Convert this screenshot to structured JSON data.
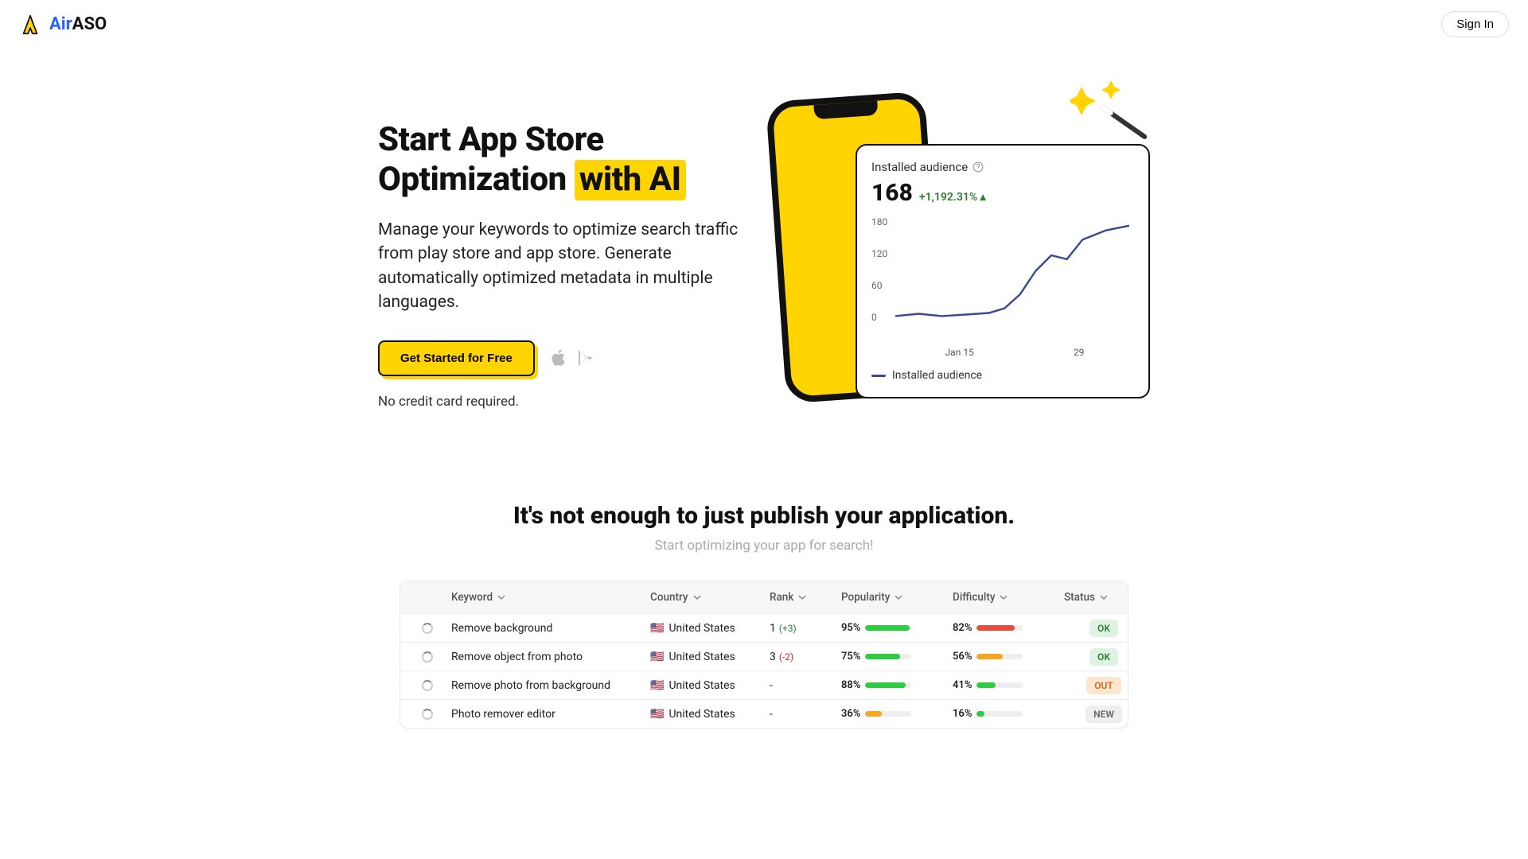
{
  "header": {
    "brand_prefix": "Air",
    "brand_suffix": "ASO",
    "signin": "Sign In"
  },
  "hero": {
    "title_line1": "Start App Store",
    "title_line2_a": "Optimization",
    "title_line2_b": "with AI",
    "subtitle": "Manage your keywords to optimize search traffic from play store and app store. Generate automatically optimized metadata in multiple languages.",
    "cta": "Get Started for Free",
    "nocard": "No credit card required."
  },
  "analytics": {
    "title": "Installed audience",
    "big": "168",
    "growth": "+1,192.31%",
    "ylabels": [
      "180",
      "120",
      "60",
      "0"
    ],
    "xlabels": [
      "Jan 15",
      "29"
    ],
    "legend": "Installed audience"
  },
  "section2": {
    "title": "It's not enough to just publish your application.",
    "sub": "Start optimizing your app for search!"
  },
  "table": {
    "headers": {
      "keyword": "Keyword",
      "country": "Country",
      "rank": "Rank",
      "popularity": "Popularity",
      "difficulty": "Difficulty",
      "status": "Status"
    },
    "rows": [
      {
        "keyword": "Remove background",
        "country": "United States",
        "rank": "1",
        "rank_delta": "(+3)",
        "delta_class": "delta-up",
        "pop": "95%",
        "pop_pct": 95,
        "pop_color": "#2ecc40",
        "diff": "82%",
        "diff_pct": 82,
        "diff_color": "#e74c3c",
        "status": "OK",
        "status_class": "badge-ok"
      },
      {
        "keyword": "Remove object from photo",
        "country": "United States",
        "rank": "3",
        "rank_delta": "(-2)",
        "delta_class": "delta-down",
        "pop": "75%",
        "pop_pct": 75,
        "pop_color": "#2ecc40",
        "diff": "56%",
        "diff_pct": 56,
        "diff_color": "#f5a623",
        "status": "OK",
        "status_class": "badge-ok"
      },
      {
        "keyword": "Remove photo from background",
        "country": "United States",
        "rank": "-",
        "rank_delta": "",
        "delta_class": "",
        "pop": "88%",
        "pop_pct": 88,
        "pop_color": "#2ecc40",
        "diff": "41%",
        "diff_pct": 41,
        "diff_color": "#2ecc40",
        "status": "OUT",
        "status_class": "badge-out"
      },
      {
        "keyword": "Photo remover editor",
        "country": "United States",
        "rank": "-",
        "rank_delta": "",
        "delta_class": "",
        "pop": "36%",
        "pop_pct": 36,
        "pop_color": "#f5a623",
        "diff": "16%",
        "diff_pct": 16,
        "diff_color": "#2ecc40",
        "status": "NEW",
        "status_class": "badge-new"
      }
    ]
  }
}
